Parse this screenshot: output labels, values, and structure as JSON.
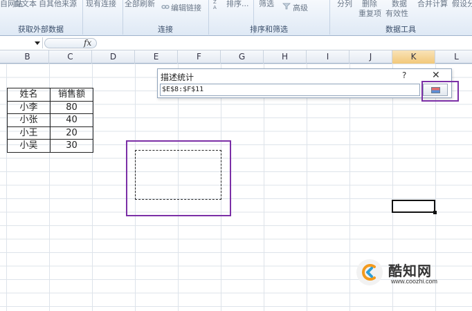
{
  "ribbon": {
    "top_items": [
      "自网站",
      "自文本",
      "自其他来源",
      "现有连接",
      "全部刷新",
      "编辑链接",
      "排序...",
      "筛选",
      "高级",
      "分列",
      "删除",
      "数据",
      "合并计算",
      "假设分"
    ],
    "second_items": [
      "重复项",
      "有效性"
    ],
    "groups": [
      "获取外部数据",
      "连接",
      "排序和筛选",
      "数据工具"
    ],
    "sort_icon": "A-Z",
    "sort_icon_top": "Z",
    "sort_icon_bottom": "A"
  },
  "formula_bar": {
    "fx": "fx"
  },
  "columns": [
    "B",
    "C",
    "D",
    "E",
    "F",
    "G",
    "H",
    "I",
    "J",
    "K",
    "L"
  ],
  "table": {
    "headers": [
      "姓名",
      "销售额"
    ],
    "rows": [
      [
        "小李",
        "80"
      ],
      [
        "小张",
        "40"
      ],
      [
        "小王",
        "20"
      ],
      [
        "小吴",
        "30"
      ]
    ]
  },
  "dialog": {
    "title": "描述统计",
    "help": "?",
    "close": "✕",
    "range_value": "$E$8:$F$11"
  },
  "watermark": {
    "name": "酷知网",
    "url": "www.coozhi.com"
  },
  "colors": {
    "highlight": "#7b2fa6"
  }
}
